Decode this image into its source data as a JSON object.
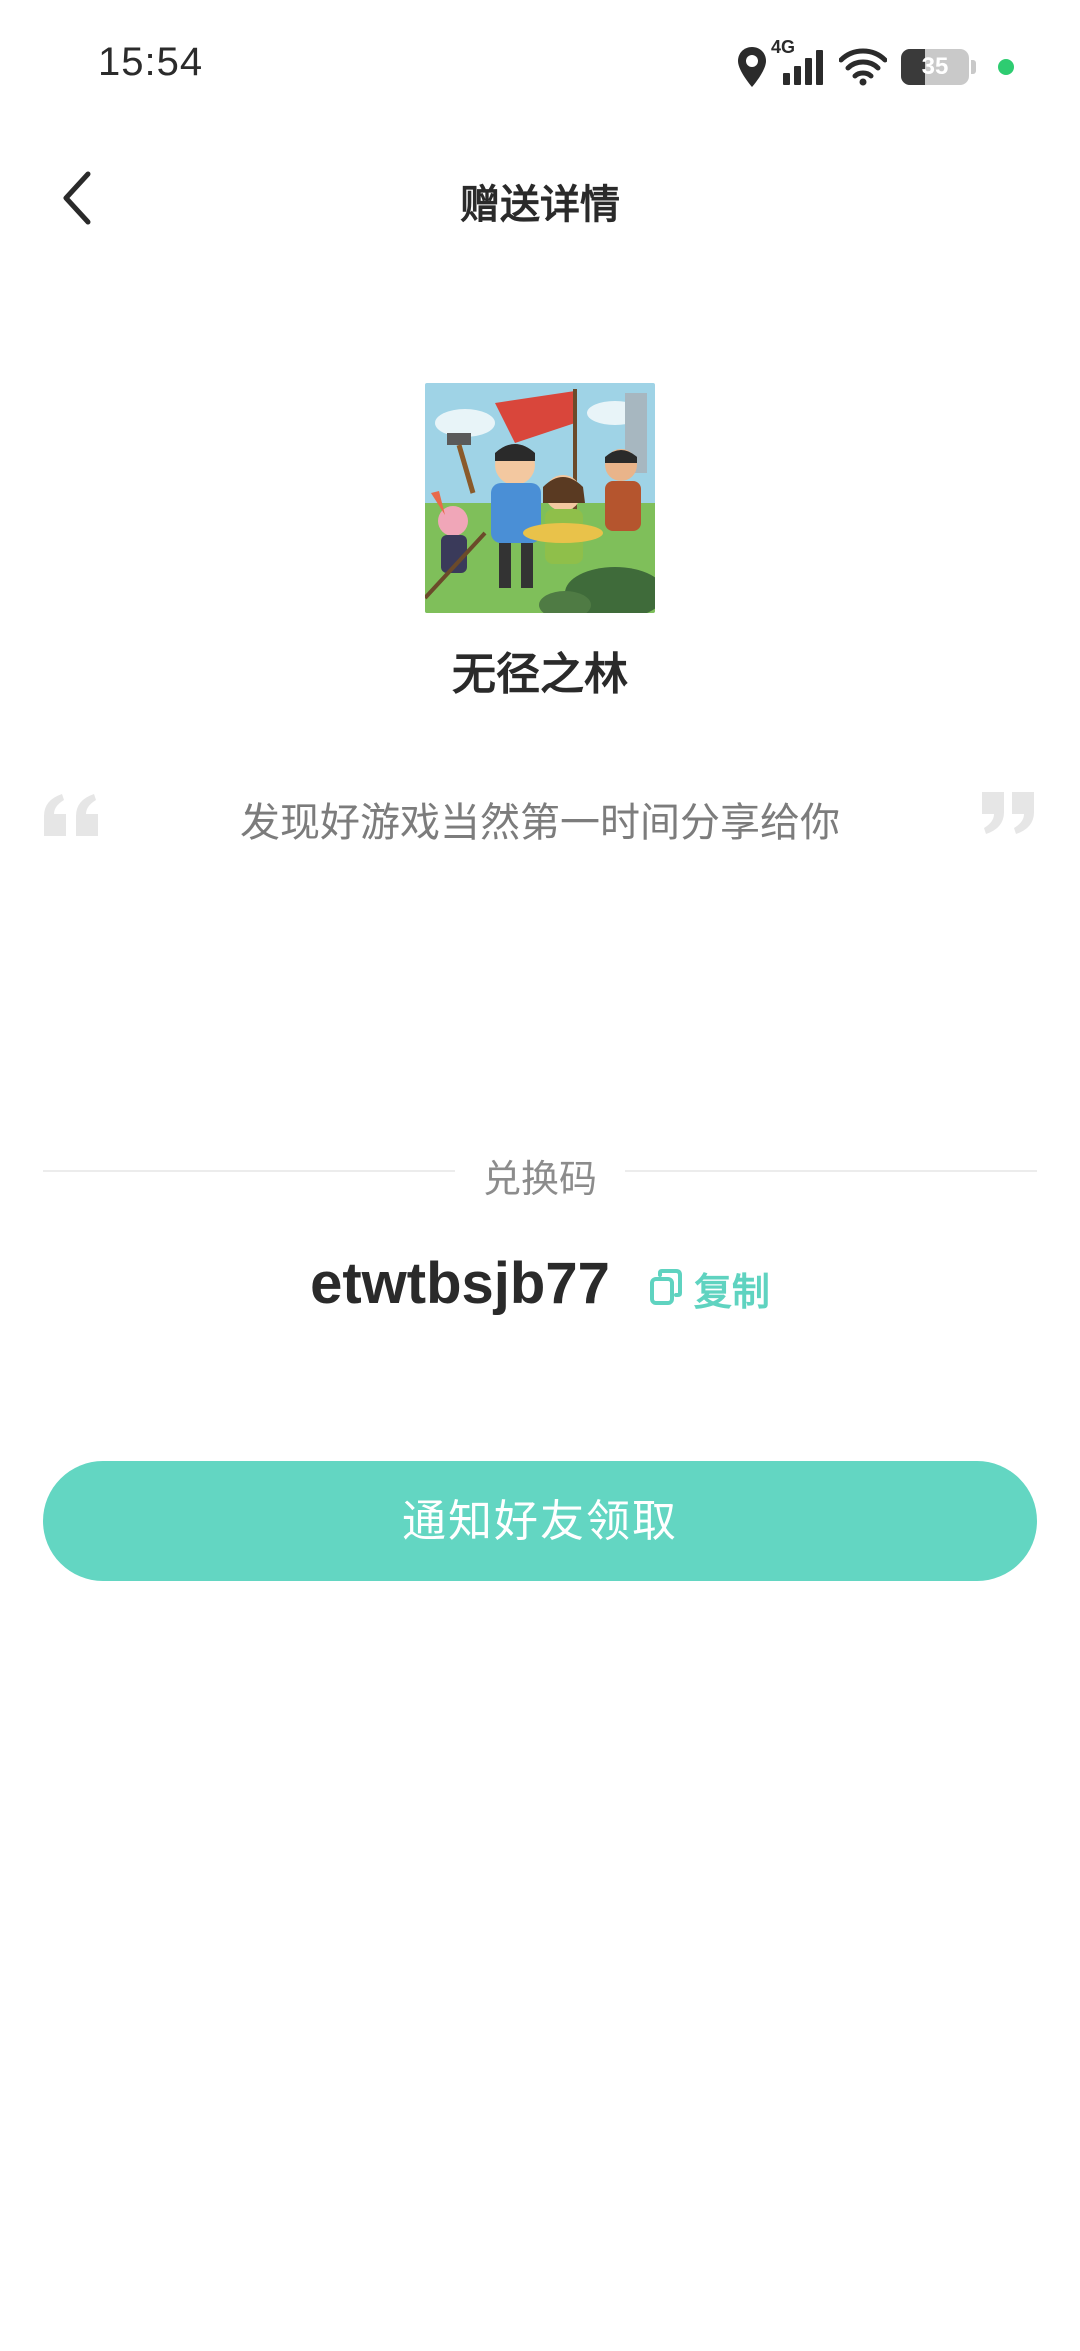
{
  "status_bar": {
    "time": "15:54",
    "network": "4G",
    "battery_level": "35",
    "battery_fraction": 0.35,
    "icons": [
      "location-icon",
      "cellular-signal-icon",
      "wifi-icon",
      "battery-icon",
      "active-indicator-dot"
    ]
  },
  "header": {
    "title": "赠送详情",
    "back_icon": "chevron-left-icon"
  },
  "game": {
    "name": "无径之林",
    "cover_description_icon": "game-cover-art"
  },
  "message": {
    "quote": "发现好游戏当然第一时间分享给你"
  },
  "redeem": {
    "label": "兑换码",
    "code": "etwtbsjb77",
    "copy_label": "复制"
  },
  "actions": {
    "notify_label": "通知好友领取"
  },
  "colors": {
    "accent": "#63d6c2",
    "copy_text": "#5fd3c0",
    "quote_mark": "#e6e6e6",
    "muted_text": "#7c7c7c"
  }
}
